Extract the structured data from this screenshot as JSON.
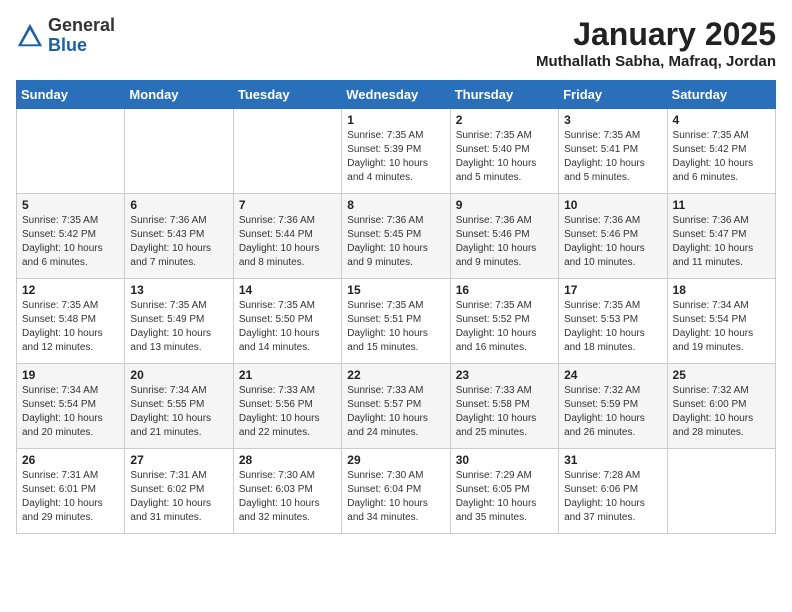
{
  "header": {
    "logo": {
      "text_general": "General",
      "text_blue": "Blue"
    },
    "title": "January 2025",
    "subtitle": "Muthallath Sabha, Mafraq, Jordan"
  },
  "calendar": {
    "days_of_week": [
      "Sunday",
      "Monday",
      "Tuesday",
      "Wednesday",
      "Thursday",
      "Friday",
      "Saturday"
    ],
    "weeks": [
      [
        {
          "day": "",
          "info": ""
        },
        {
          "day": "",
          "info": ""
        },
        {
          "day": "",
          "info": ""
        },
        {
          "day": "1",
          "info": "Sunrise: 7:35 AM\nSunset: 5:39 PM\nDaylight: 10 hours\nand 4 minutes."
        },
        {
          "day": "2",
          "info": "Sunrise: 7:35 AM\nSunset: 5:40 PM\nDaylight: 10 hours\nand 5 minutes."
        },
        {
          "day": "3",
          "info": "Sunrise: 7:35 AM\nSunset: 5:41 PM\nDaylight: 10 hours\nand 5 minutes."
        },
        {
          "day": "4",
          "info": "Sunrise: 7:35 AM\nSunset: 5:42 PM\nDaylight: 10 hours\nand 6 minutes."
        }
      ],
      [
        {
          "day": "5",
          "info": "Sunrise: 7:35 AM\nSunset: 5:42 PM\nDaylight: 10 hours\nand 6 minutes."
        },
        {
          "day": "6",
          "info": "Sunrise: 7:36 AM\nSunset: 5:43 PM\nDaylight: 10 hours\nand 7 minutes."
        },
        {
          "day": "7",
          "info": "Sunrise: 7:36 AM\nSunset: 5:44 PM\nDaylight: 10 hours\nand 8 minutes."
        },
        {
          "day": "8",
          "info": "Sunrise: 7:36 AM\nSunset: 5:45 PM\nDaylight: 10 hours\nand 9 minutes."
        },
        {
          "day": "9",
          "info": "Sunrise: 7:36 AM\nSunset: 5:46 PM\nDaylight: 10 hours\nand 9 minutes."
        },
        {
          "day": "10",
          "info": "Sunrise: 7:36 AM\nSunset: 5:46 PM\nDaylight: 10 hours\nand 10 minutes."
        },
        {
          "day": "11",
          "info": "Sunrise: 7:36 AM\nSunset: 5:47 PM\nDaylight: 10 hours\nand 11 minutes."
        }
      ],
      [
        {
          "day": "12",
          "info": "Sunrise: 7:35 AM\nSunset: 5:48 PM\nDaylight: 10 hours\nand 12 minutes."
        },
        {
          "day": "13",
          "info": "Sunrise: 7:35 AM\nSunset: 5:49 PM\nDaylight: 10 hours\nand 13 minutes."
        },
        {
          "day": "14",
          "info": "Sunrise: 7:35 AM\nSunset: 5:50 PM\nDaylight: 10 hours\nand 14 minutes."
        },
        {
          "day": "15",
          "info": "Sunrise: 7:35 AM\nSunset: 5:51 PM\nDaylight: 10 hours\nand 15 minutes."
        },
        {
          "day": "16",
          "info": "Sunrise: 7:35 AM\nSunset: 5:52 PM\nDaylight: 10 hours\nand 16 minutes."
        },
        {
          "day": "17",
          "info": "Sunrise: 7:35 AM\nSunset: 5:53 PM\nDaylight: 10 hours\nand 18 minutes."
        },
        {
          "day": "18",
          "info": "Sunrise: 7:34 AM\nSunset: 5:54 PM\nDaylight: 10 hours\nand 19 minutes."
        }
      ],
      [
        {
          "day": "19",
          "info": "Sunrise: 7:34 AM\nSunset: 5:54 PM\nDaylight: 10 hours\nand 20 minutes."
        },
        {
          "day": "20",
          "info": "Sunrise: 7:34 AM\nSunset: 5:55 PM\nDaylight: 10 hours\nand 21 minutes."
        },
        {
          "day": "21",
          "info": "Sunrise: 7:33 AM\nSunset: 5:56 PM\nDaylight: 10 hours\nand 22 minutes."
        },
        {
          "day": "22",
          "info": "Sunrise: 7:33 AM\nSunset: 5:57 PM\nDaylight: 10 hours\nand 24 minutes."
        },
        {
          "day": "23",
          "info": "Sunrise: 7:33 AM\nSunset: 5:58 PM\nDaylight: 10 hours\nand 25 minutes."
        },
        {
          "day": "24",
          "info": "Sunrise: 7:32 AM\nSunset: 5:59 PM\nDaylight: 10 hours\nand 26 minutes."
        },
        {
          "day": "25",
          "info": "Sunrise: 7:32 AM\nSunset: 6:00 PM\nDaylight: 10 hours\nand 28 minutes."
        }
      ],
      [
        {
          "day": "26",
          "info": "Sunrise: 7:31 AM\nSunset: 6:01 PM\nDaylight: 10 hours\nand 29 minutes."
        },
        {
          "day": "27",
          "info": "Sunrise: 7:31 AM\nSunset: 6:02 PM\nDaylight: 10 hours\nand 31 minutes."
        },
        {
          "day": "28",
          "info": "Sunrise: 7:30 AM\nSunset: 6:03 PM\nDaylight: 10 hours\nand 32 minutes."
        },
        {
          "day": "29",
          "info": "Sunrise: 7:30 AM\nSunset: 6:04 PM\nDaylight: 10 hours\nand 34 minutes."
        },
        {
          "day": "30",
          "info": "Sunrise: 7:29 AM\nSunset: 6:05 PM\nDaylight: 10 hours\nand 35 minutes."
        },
        {
          "day": "31",
          "info": "Sunrise: 7:28 AM\nSunset: 6:06 PM\nDaylight: 10 hours\nand 37 minutes."
        },
        {
          "day": "",
          "info": ""
        }
      ]
    ]
  }
}
